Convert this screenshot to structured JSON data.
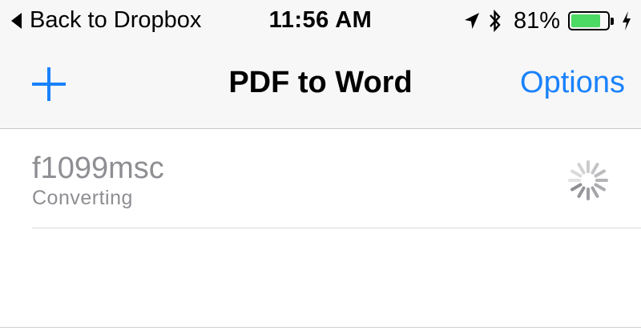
{
  "status_bar": {
    "back_label": "Back to Dropbox",
    "time": "11:56 AM",
    "battery_percent": "81%",
    "battery_level": 0.81,
    "icons": [
      "location-arrow-icon",
      "bluetooth-icon",
      "battery-icon",
      "charging-bolt-icon"
    ]
  },
  "nav": {
    "title": "PDF to Word",
    "options_label": "Options",
    "add_icon": "plus-icon"
  },
  "files": [
    {
      "name": "f1099msc",
      "status": "Converting",
      "icon": "activity-spinner-icon"
    }
  ],
  "colors": {
    "accent": "#1a82fb",
    "battery_fill": "#4cd964",
    "muted_text": "#8e8e93",
    "bar_background": "#f7f7f7"
  }
}
